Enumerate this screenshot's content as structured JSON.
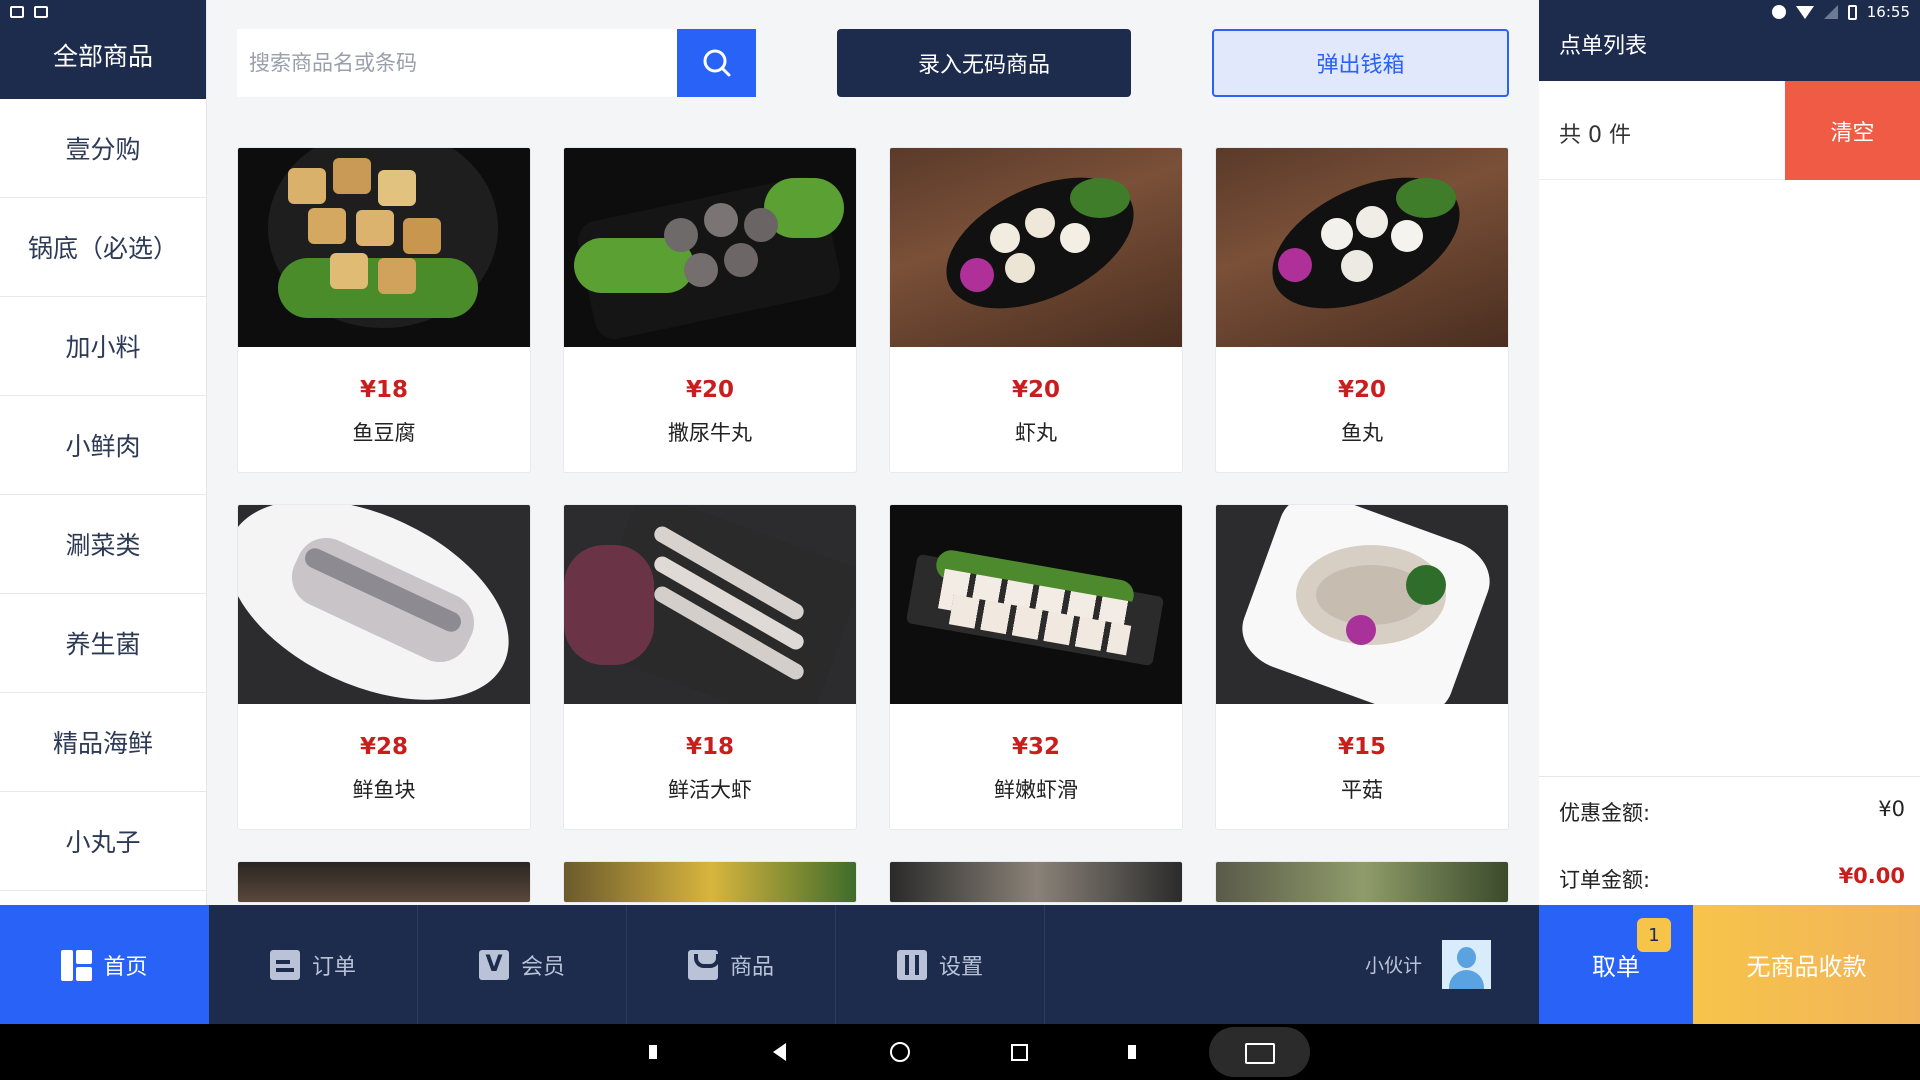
{
  "status_bar": {
    "time": "16:55"
  },
  "sidebar": {
    "all_label": "全部商品",
    "items": [
      {
        "label": "壹分购"
      },
      {
        "label": "锅底（必选）"
      },
      {
        "label": "加小料"
      },
      {
        "label": "小鲜肉"
      },
      {
        "label": "涮菜类"
      },
      {
        "label": "养生菌"
      },
      {
        "label": "精品海鲜"
      },
      {
        "label": "小丸子"
      }
    ]
  },
  "search": {
    "placeholder": "搜索商品名或条码",
    "value": ""
  },
  "toolbar": {
    "enter_no_code_label": "录入无码商品",
    "open_cash_drawer_label": "弹出钱箱"
  },
  "products": [
    {
      "price": "¥18",
      "name": "鱼豆腐"
    },
    {
      "price": "¥20",
      "name": "撒尿牛丸"
    },
    {
      "price": "¥20",
      "name": "虾丸"
    },
    {
      "price": "¥20",
      "name": "鱼丸"
    },
    {
      "price": "¥28",
      "name": "鲜鱼块"
    },
    {
      "price": "¥18",
      "name": "鲜活大虾"
    },
    {
      "price": "¥32",
      "name": "鲜嫩虾滑"
    },
    {
      "price": "¥15",
      "name": "平菇"
    }
  ],
  "order_panel": {
    "title": "点单列表",
    "count_text": "共 0 件",
    "clear_label": "清空",
    "discount_label": "优惠金额:",
    "discount_value": "¥0",
    "total_label": "订单金额:",
    "total_value": "¥0.00"
  },
  "bottom_nav": {
    "items": [
      {
        "label": "首页",
        "icon": "home-icon",
        "active": true
      },
      {
        "label": "订单",
        "icon": "order-icon",
        "active": false
      },
      {
        "label": "会员",
        "icon": "member-icon",
        "active": false
      },
      {
        "label": "商品",
        "icon": "goods-icon",
        "active": false
      },
      {
        "label": "设置",
        "icon": "settings-icon",
        "active": false
      }
    ],
    "staff_name": "小伙计",
    "take_order_label": "取单",
    "take_order_badge": "1",
    "no_goods_pay_label": "无商品收款"
  },
  "colors": {
    "navy": "#1d2b4c",
    "accent_blue": "#2962f7",
    "price_red": "#c81e1e",
    "clear_red": "#ef5b44",
    "pay_yellow": "#f7c44a"
  }
}
